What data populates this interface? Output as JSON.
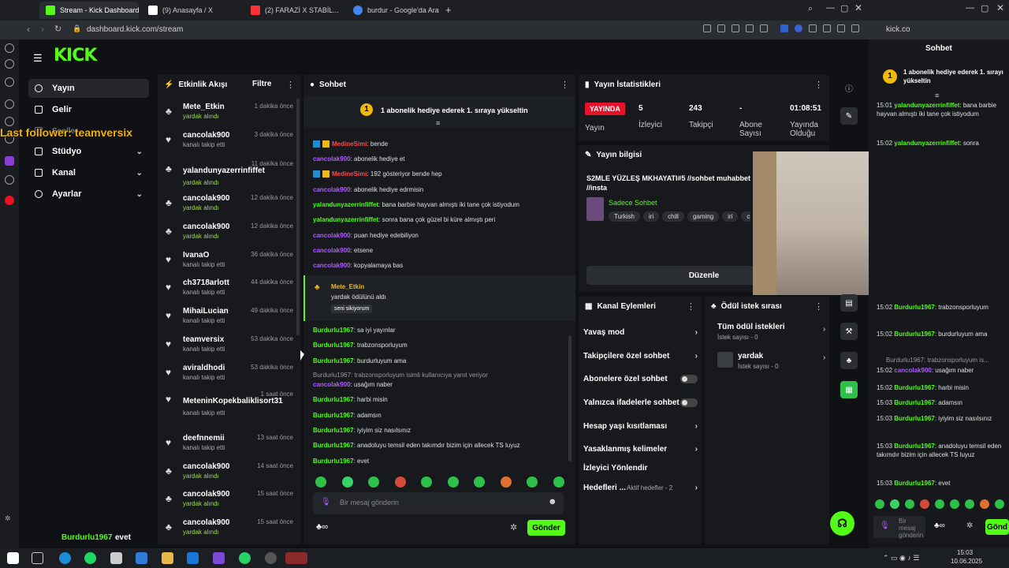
{
  "browser": {
    "tabs": [
      {
        "label": "Stream - Kick Dashboard",
        "color": "#53fc18",
        "active": true
      },
      {
        "label": "(9) Anasayfa / X",
        "color": "#ffffff",
        "active": false
      },
      {
        "label": "(2) FARAZİ X STABİL...",
        "color": "#ff3333",
        "active": false
      },
      {
        "label": "burdur - Google'da Ara",
        "color": "#4285f4",
        "active": false
      }
    ],
    "url": "dashboard.kick.com/stream",
    "url2": "kick.co"
  },
  "overlay": {
    "last_follower": "Last follower: teamversix"
  },
  "sidebar": {
    "logo": "KICK",
    "items": [
      {
        "label": "Yayın",
        "active": true,
        "chev": ""
      },
      {
        "label": "Gelir",
        "active": false,
        "chev": ""
      },
      {
        "label": "Stüdyo",
        "active": false,
        "chev": "⌄"
      },
      {
        "label": "Kanal",
        "active": false,
        "chev": "⌄"
      },
      {
        "label": "Ayarlar",
        "active": false,
        "chev": "⌄"
      }
    ],
    "hidden_item": "Ses/ler",
    "footer_user": "Burdurlu1967",
    "footer_msg": "evet"
  },
  "activity": {
    "title": "Etkinlik Akışı",
    "filter": "Filtre",
    "events": [
      {
        "name": "Mete_Etkin",
        "sub": "yardak alındı",
        "time": "1 dakika önce",
        "icon": "♣",
        "green": true
      },
      {
        "name": "cancolak900",
        "sub": "kanalı takip etti",
        "time": "3 dakika önce",
        "icon": "♥",
        "green": false
      },
      {
        "name": "yalandunyazerrinfiffet",
        "sub": "yardak alındı",
        "time": "11 dakika önce",
        "icon": "♣",
        "green": true
      },
      {
        "name": "cancolak900",
        "sub": "yardak alındı",
        "time": "12 dakika önce",
        "icon": "♣",
        "green": true
      },
      {
        "name": "cancolak900",
        "sub": "yardak alındı",
        "time": "12 dakika önce",
        "icon": "♣",
        "green": true
      },
      {
        "name": "IvanaO",
        "sub": "kanalı takip etti",
        "time": "36 dakika önce",
        "icon": "♥",
        "green": false
      },
      {
        "name": "ch3718arlott",
        "sub": "kanalı takip etti",
        "time": "44 dakika önce",
        "icon": "♥",
        "green": false
      },
      {
        "name": "MihaiLucian",
        "sub": "kanalı takip etti",
        "time": "49 dakika önce",
        "icon": "♥",
        "green": false
      },
      {
        "name": "teamversix",
        "sub": "kanalı takip etti",
        "time": "53 dakika önce",
        "icon": "♥",
        "green": false
      },
      {
        "name": "aviraldhodi",
        "sub": "kanalı takip etti",
        "time": "53 dakika önce",
        "icon": "♥",
        "green": false
      },
      {
        "name": "MeteninKopekbaliklisort31",
        "sub": "kanalı takip etti",
        "time": "1 saat önce",
        "icon": "♥",
        "green": false
      },
      {
        "name": "deefnnemii",
        "sub": "kanalı takip etti",
        "time": "13 saat önce",
        "icon": "♥",
        "green": false
      },
      {
        "name": "cancolak900",
        "sub": "yardak alındı",
        "time": "14 saat önce",
        "icon": "♣",
        "green": true
      },
      {
        "name": "cancolak900",
        "sub": "yardak alındı",
        "time": "15 saat önce",
        "icon": "♣",
        "green": true
      },
      {
        "name": "cancolak900",
        "sub": "yardak alındı",
        "time": "15 saat önce",
        "icon": "♣",
        "green": true
      }
    ]
  },
  "chat": {
    "title": "Sohbet",
    "pinned": "1 abonelik hediye ederek 1. sıraya yükseltin",
    "messages": [
      {
        "user": "MedineSimi",
        "text": ": bende",
        "color": "red",
        "badges": true
      },
      {
        "user": "cancolak900",
        "text": ": abonelik hediye et",
        "color": "purple",
        "badges": false
      },
      {
        "user": "MedineSimi",
        "text": ": 192 gösteriyor bende hep",
        "color": "red",
        "badges": true
      },
      {
        "user": "cancolak900",
        "text": ": abonelik hediye edrmisin",
        "color": "purple",
        "badges": false
      },
      {
        "user": "yalandunyazerrinfiffet",
        "text": ": bana barbie hayvan almıştı iki tane çok istiyodum",
        "color": "green",
        "badges": false
      },
      {
        "user": "yalandunyazerrinfiffet",
        "text": ": sonra bana çok güzel bi küre almıştı peri",
        "color": "green",
        "badges": false
      },
      {
        "user": "cancolak900",
        "text": ": puan hediye edebiliyon",
        "color": "purple",
        "badges": false
      },
      {
        "user": "cancolak900",
        "text": ": etsene",
        "color": "purple",
        "badges": false
      },
      {
        "user": "cancolak900",
        "text": ": kopyalamaya bas",
        "color": "purple",
        "badges": false
      }
    ],
    "reward": {
      "user": "Mete_Etkin",
      "line": "yardak ödülünü aldı",
      "quote": "seni sikiyorum"
    },
    "messages2": [
      {
        "user": "Burdurlu1967",
        "text": ": sa iyi yayınlar",
        "color": "green"
      },
      {
        "user": "Burdurlu1967",
        "text": ": trabzonsporluyum",
        "color": "green"
      },
      {
        "user": "Burdurlu1967",
        "text": ": burdurluyum ama",
        "color": "green"
      }
    ],
    "reply_note": "Burdurlu1967: trabzonsporluyum isimli kullanıcıya yanıt veriyor",
    "messages3": [
      {
        "user": "cancolak900",
        "text": ": usağım naber",
        "color": "purple"
      },
      {
        "user": "Burdurlu1967",
        "text": ": harbi misin",
        "color": "green"
      },
      {
        "user": "Burdurlu1967",
        "text": ": adamsın",
        "color": "green"
      },
      {
        "user": "Burdurlu1967",
        "text": ": iyiyim siz nasılsınız",
        "color": "green"
      },
      {
        "user": "Burdurlu1967",
        "text": ": anadoluyu temsil eden takımdır bizim için allecek TS luyuz",
        "color": "green"
      },
      {
        "user": "Burdurlu1967",
        "text": ": evet",
        "color": "green"
      }
    ],
    "input_placeholder": "Bir mesaj gönderin",
    "send": "Gönder"
  },
  "stats": {
    "title": "Yayın İstatistikleri",
    "live": "YAYINDA",
    "live_label": "Yayın",
    "items": [
      {
        "value": "5",
        "label": "İzleyici"
      },
      {
        "value": "243",
        "label": "Takipçi"
      },
      {
        "value": "-",
        "label": "Abone Sayısı"
      },
      {
        "value": "01:08:51",
        "label": "Yayında Olduğu"
      }
    ]
  },
  "info": {
    "title": "Yayın bilgisi",
    "stream_title": "S2MLE YÜZLEŞ MKHAYATI#5 //sohbet muhabbet //insta",
    "category": "Sadece Sohbet",
    "tags": [
      "Turkish",
      "iri",
      "chill",
      "gaming",
      "iri",
      "ch"
    ],
    "edit": "Düzenle"
  },
  "channel_actions": {
    "title": "Kanal Eylemleri",
    "items": [
      {
        "label": "Yavaş mod",
        "type": "arrow",
        "extra": ""
      },
      {
        "label": "Takipçilere özel sohbet",
        "type": "arrow",
        "extra": ""
      },
      {
        "label": "Abonelere özel sohbet",
        "type": "toggle",
        "extra": ""
      },
      {
        "label": "Yalnızca ifadelerle sohbet",
        "type": "toggle",
        "extra": ""
      },
      {
        "label": "Hesap yaşı kısıtlaması",
        "type": "arrow",
        "extra": ""
      },
      {
        "label": "Yasaklanmış kelimeler",
        "type": "arrow",
        "extra": ""
      },
      {
        "label": "İzleyici Yönlendir",
        "type": "none",
        "extra": ""
      },
      {
        "label": "Hedefleri ...",
        "type": "arrow",
        "extra": "Aktif hedefler - 2"
      }
    ]
  },
  "rewards": {
    "title": "Ödül istek sırası",
    "all": "Tüm ödül istekleri",
    "all_count": "İstek sayısı - 0",
    "item": "yardak",
    "item_count": "İstek sayısı - 0"
  },
  "popout": {
    "title": "Sohbet",
    "pinned": "1 abonelik hediye ederek 1. sırayı yükseltin",
    "lines": [
      {
        "ts": "15:01",
        "user": "yalandunyazerrinfiffet",
        "text": ": bana barbie hayvan almıştı iki tane çok istiyodum"
      },
      {
        "ts": "15:02",
        "user": "yalandunyazerrinfiffet",
        "text": ": sonra"
      },
      {
        "ts": "15:02",
        "user": "Burdurlu1967",
        "text": ": trabzonsporluyum"
      },
      {
        "ts": "15:02",
        "user": "Burdurlu1967",
        "text": ": burdurluyum ama"
      },
      {
        "ts": "15:02",
        "user": "cancolak900",
        "text": ": usağım naber"
      },
      {
        "ts": "15:02",
        "user": "Burdurlu1967",
        "text": ": harbi misin"
      },
      {
        "ts": "15:03",
        "user": "Burdurlu1967",
        "text": ": adamsın"
      },
      {
        "ts": "15:03",
        "user": "Burdurlu1967",
        "text": ": iyiyim siz nasılsınız"
      },
      {
        "ts": "15:03",
        "user": "Burdurlu1967",
        "text": ": anadoluyu temsil eden takımdır bizim için allecek TS luyuz"
      },
      {
        "ts": "15:03",
        "user": "Burdurlu1967",
        "text": ": evet"
      }
    ],
    "reply_note": "Burdurlu1967: trabzonsporluyum is...",
    "input_placeholder": "Bir mesaj gönderin",
    "send": "Gönd"
  },
  "taskbar": {
    "time": "15:03",
    "date": "10.06.2025"
  },
  "colors": {
    "accent": "#53fc18",
    "live": "#e6112b"
  }
}
